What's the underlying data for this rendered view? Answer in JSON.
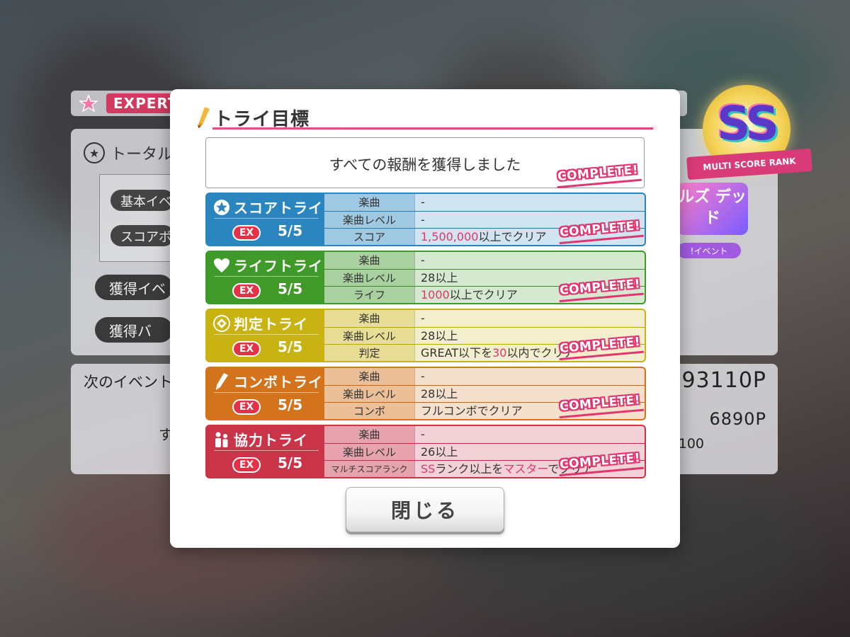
{
  "background": {
    "difficulty": "EXPERT",
    "total_label": "トータル",
    "pill_1": "基本イベ",
    "pill_2": "スコアボ",
    "button_1": "獲得イベ",
    "button_2": "獲得バ",
    "next_event_label": "次のイベント",
    "su_text": "す",
    "points_1": "93110P",
    "points_2": "6890P",
    "points_3": "100",
    "rank_text": "SS",
    "rank_ribbon": "MULTI SCORE RANK",
    "event_logo": "ルズ デッド",
    "event_pill": "!イベント"
  },
  "modal": {
    "title": "トライ目標",
    "reward_text": "すべての報酬を獲得しました",
    "complete_label": "COMPLETE!",
    "close_label": "閉じる"
  },
  "tries": [
    {
      "name": "スコアトライ",
      "icon": "star-icon",
      "color": "#2b86bf",
      "ex": "EX",
      "progress": "5/5",
      "rows": [
        {
          "key": "楽曲",
          "value": "-"
        },
        {
          "key": "楽曲レベル",
          "value": "-"
        },
        {
          "key": "スコア",
          "value_hl": "1,500,000",
          "value": "以上でクリア"
        }
      ]
    },
    {
      "name": "ライフトライ",
      "icon": "heart-icon",
      "color": "#3f9a2a",
      "ex": "EX",
      "progress": "5/5",
      "rows": [
        {
          "key": "楽曲",
          "value": "-"
        },
        {
          "key": "楽曲レベル",
          "value": "28以上"
        },
        {
          "key": "ライフ",
          "value_hl": "1000",
          "value": "以上でクリア"
        }
      ]
    },
    {
      "name": "判定トライ",
      "icon": "target-icon",
      "color": "#c9b313",
      "ex": "EX",
      "progress": "5/5",
      "rows": [
        {
          "key": "楽曲",
          "value": "-"
        },
        {
          "key": "楽曲レベル",
          "value": "28以上"
        },
        {
          "key": "判定",
          "value_pre": "GREAT以下を",
          "value_hl": "30",
          "value": "以内でクリア"
        }
      ]
    },
    {
      "name": "コンボトライ",
      "icon": "pen-icon",
      "color": "#d3731c",
      "ex": "EX",
      "progress": "5/5",
      "rows": [
        {
          "key": "楽曲",
          "value": "-"
        },
        {
          "key": "楽曲レベル",
          "value": "28以上"
        },
        {
          "key": "コンボ",
          "value": "フルコンボでクリア"
        }
      ]
    },
    {
      "name": "協力トライ",
      "icon": "people-icon",
      "color": "#c93449",
      "ex": "EX",
      "progress": "5/5",
      "rows": [
        {
          "key": "楽曲",
          "value": "-"
        },
        {
          "key": "楽曲レベル",
          "value": "26以上"
        },
        {
          "key": "マルチスコアランク",
          "value_hl": "SS",
          "value": "ランク以上を",
          "value_hl2": "マスター",
          "value_post": "でクリア"
        }
      ]
    }
  ]
}
